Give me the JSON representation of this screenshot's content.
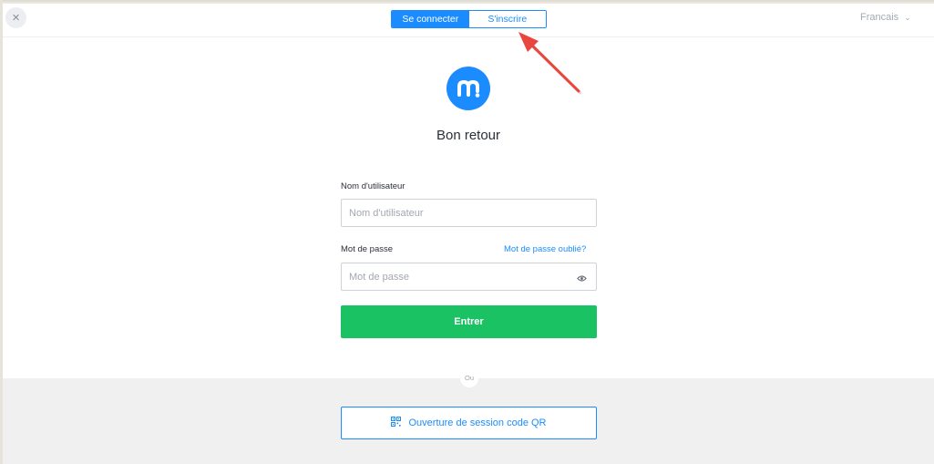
{
  "header": {
    "close_glyph": "×",
    "tabs": [
      {
        "label": "Se connecter",
        "active": true
      },
      {
        "label": "S'inscrire",
        "active": false
      }
    ],
    "language": "Francais",
    "language_chevron": "⌄"
  },
  "annotation": {
    "arrow_color": "#e8463f"
  },
  "login": {
    "logo_icon": "m-logo-icon",
    "title": "Bon retour",
    "username_label": "Nom d'utilisateur",
    "username_placeholder": "Nom d'utilisateur",
    "password_label": "Mot de passe",
    "forgot_password": "Mot de passe oublié?",
    "password_placeholder": "Mot de passe",
    "submit_label": "Entrer"
  },
  "alt_login": {
    "divider_text": "Ou",
    "qr_label": "Ouverture de session code QR",
    "qr_icon": "qr-code-icon"
  },
  "colors": {
    "accent": "#1a8cff",
    "submit": "#1bc264",
    "text": "#2b2f3a",
    "placeholder": "#a2a7b0",
    "bottom_bg": "#f0f0f1"
  }
}
